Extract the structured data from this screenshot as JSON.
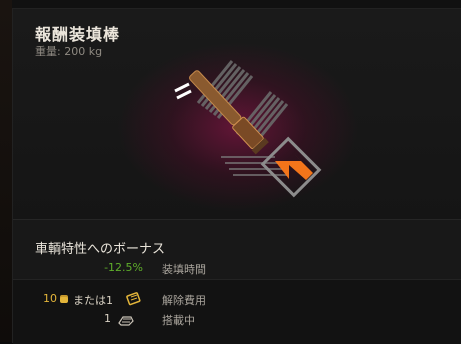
{
  "item": {
    "title": "報酬装填棒",
    "weight": "重量: 200 kg"
  },
  "bonus": {
    "heading": "車輌特性へのボーナス",
    "value": "-12.5%",
    "label": "装填時間"
  },
  "costs": {
    "demount_gold": "10",
    "or_text": "または1",
    "demount_label": "解除費用",
    "mounted_count": "1",
    "mounted_label": "搭載中"
  },
  "colors": {
    "title": "#ece6dc",
    "bonus_value": "#5fae2a",
    "gold": "#e3b53a",
    "accent_glow": "#b4145a",
    "arrow": "#ff7a1a"
  },
  "icons": {
    "demount": "ticket-icon",
    "mounted": "tank-gear-icon",
    "gold": "gold-coin-icon"
  }
}
